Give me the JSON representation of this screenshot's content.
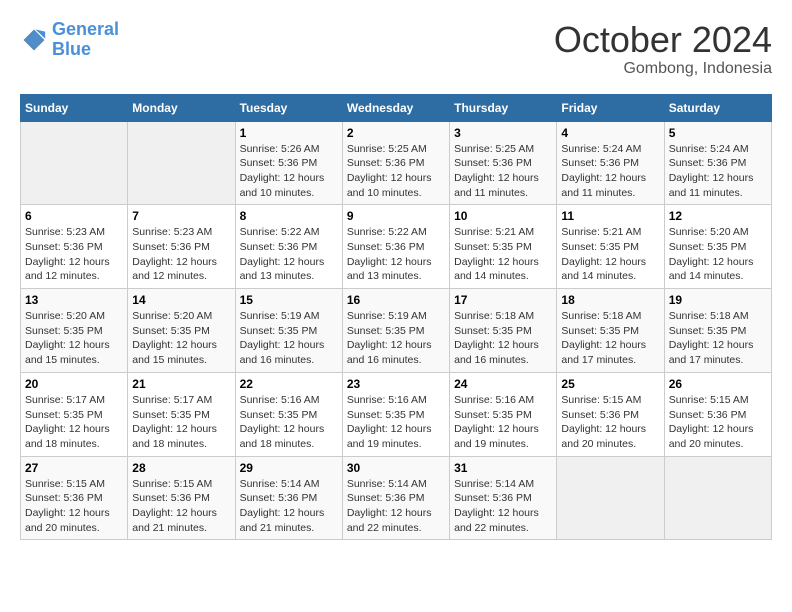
{
  "header": {
    "logo_line1": "General",
    "logo_line2": "Blue",
    "month": "October 2024",
    "location": "Gombong, Indonesia"
  },
  "weekdays": [
    "Sunday",
    "Monday",
    "Tuesday",
    "Wednesday",
    "Thursday",
    "Friday",
    "Saturday"
  ],
  "weeks": [
    [
      {
        "day": "",
        "empty": true
      },
      {
        "day": "",
        "empty": true
      },
      {
        "day": "1",
        "sunrise": "5:26 AM",
        "sunset": "5:36 PM",
        "daylight": "12 hours and 10 minutes."
      },
      {
        "day": "2",
        "sunrise": "5:25 AM",
        "sunset": "5:36 PM",
        "daylight": "12 hours and 10 minutes."
      },
      {
        "day": "3",
        "sunrise": "5:25 AM",
        "sunset": "5:36 PM",
        "daylight": "12 hours and 11 minutes."
      },
      {
        "day": "4",
        "sunrise": "5:24 AM",
        "sunset": "5:36 PM",
        "daylight": "12 hours and 11 minutes."
      },
      {
        "day": "5",
        "sunrise": "5:24 AM",
        "sunset": "5:36 PM",
        "daylight": "12 hours and 11 minutes."
      }
    ],
    [
      {
        "day": "6",
        "sunrise": "5:23 AM",
        "sunset": "5:36 PM",
        "daylight": "12 hours and 12 minutes."
      },
      {
        "day": "7",
        "sunrise": "5:23 AM",
        "sunset": "5:36 PM",
        "daylight": "12 hours and 12 minutes."
      },
      {
        "day": "8",
        "sunrise": "5:22 AM",
        "sunset": "5:36 PM",
        "daylight": "12 hours and 13 minutes."
      },
      {
        "day": "9",
        "sunrise": "5:22 AM",
        "sunset": "5:36 PM",
        "daylight": "12 hours and 13 minutes."
      },
      {
        "day": "10",
        "sunrise": "5:21 AM",
        "sunset": "5:35 PM",
        "daylight": "12 hours and 14 minutes."
      },
      {
        "day": "11",
        "sunrise": "5:21 AM",
        "sunset": "5:35 PM",
        "daylight": "12 hours and 14 minutes."
      },
      {
        "day": "12",
        "sunrise": "5:20 AM",
        "sunset": "5:35 PM",
        "daylight": "12 hours and 14 minutes."
      }
    ],
    [
      {
        "day": "13",
        "sunrise": "5:20 AM",
        "sunset": "5:35 PM",
        "daylight": "12 hours and 15 minutes."
      },
      {
        "day": "14",
        "sunrise": "5:20 AM",
        "sunset": "5:35 PM",
        "daylight": "12 hours and 15 minutes."
      },
      {
        "day": "15",
        "sunrise": "5:19 AM",
        "sunset": "5:35 PM",
        "daylight": "12 hours and 16 minutes."
      },
      {
        "day": "16",
        "sunrise": "5:19 AM",
        "sunset": "5:35 PM",
        "daylight": "12 hours and 16 minutes."
      },
      {
        "day": "17",
        "sunrise": "5:18 AM",
        "sunset": "5:35 PM",
        "daylight": "12 hours and 16 minutes."
      },
      {
        "day": "18",
        "sunrise": "5:18 AM",
        "sunset": "5:35 PM",
        "daylight": "12 hours and 17 minutes."
      },
      {
        "day": "19",
        "sunrise": "5:18 AM",
        "sunset": "5:35 PM",
        "daylight": "12 hours and 17 minutes."
      }
    ],
    [
      {
        "day": "20",
        "sunrise": "5:17 AM",
        "sunset": "5:35 PM",
        "daylight": "12 hours and 18 minutes."
      },
      {
        "day": "21",
        "sunrise": "5:17 AM",
        "sunset": "5:35 PM",
        "daylight": "12 hours and 18 minutes."
      },
      {
        "day": "22",
        "sunrise": "5:16 AM",
        "sunset": "5:35 PM",
        "daylight": "12 hours and 18 minutes."
      },
      {
        "day": "23",
        "sunrise": "5:16 AM",
        "sunset": "5:35 PM",
        "daylight": "12 hours and 19 minutes."
      },
      {
        "day": "24",
        "sunrise": "5:16 AM",
        "sunset": "5:35 PM",
        "daylight": "12 hours and 19 minutes."
      },
      {
        "day": "25",
        "sunrise": "5:15 AM",
        "sunset": "5:36 PM",
        "daylight": "12 hours and 20 minutes."
      },
      {
        "day": "26",
        "sunrise": "5:15 AM",
        "sunset": "5:36 PM",
        "daylight": "12 hours and 20 minutes."
      }
    ],
    [
      {
        "day": "27",
        "sunrise": "5:15 AM",
        "sunset": "5:36 PM",
        "daylight": "12 hours and 20 minutes."
      },
      {
        "day": "28",
        "sunrise": "5:15 AM",
        "sunset": "5:36 PM",
        "daylight": "12 hours and 21 minutes."
      },
      {
        "day": "29",
        "sunrise": "5:14 AM",
        "sunset": "5:36 PM",
        "daylight": "12 hours and 21 minutes."
      },
      {
        "day": "30",
        "sunrise": "5:14 AM",
        "sunset": "5:36 PM",
        "daylight": "12 hours and 22 minutes."
      },
      {
        "day": "31",
        "sunrise": "5:14 AM",
        "sunset": "5:36 PM",
        "daylight": "12 hours and 22 minutes."
      },
      {
        "day": "",
        "empty": true
      },
      {
        "day": "",
        "empty": true
      }
    ]
  ]
}
